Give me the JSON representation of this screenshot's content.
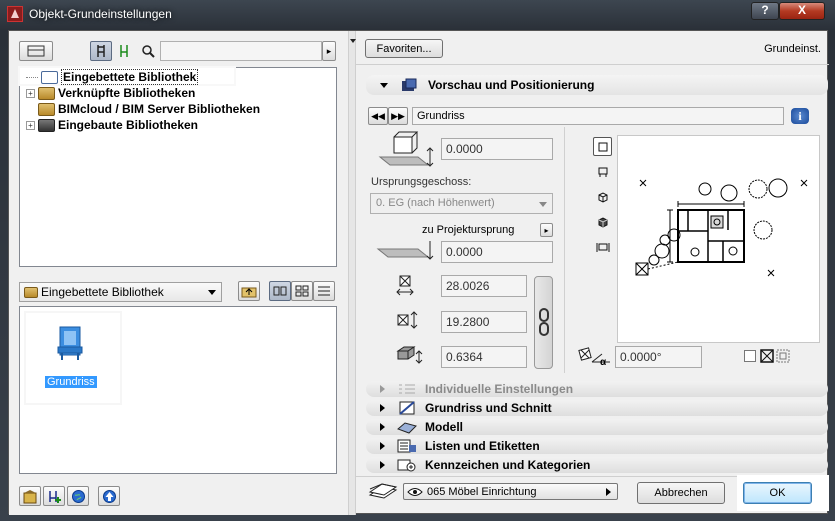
{
  "window": {
    "title": "Objekt-Grundeinstellungen",
    "help_label": "?",
    "close_label": "X"
  },
  "left": {
    "search": {
      "value": "",
      "placeholder": ""
    },
    "tree": [
      {
        "label": "Eingebettete Bibliothek",
        "expander": "",
        "selected": true
      },
      {
        "label": "Verknüpfte Bibliotheken",
        "expander": "+"
      },
      {
        "label": "BIMcloud / BIM Server Bibliotheken",
        "expander": ""
      },
      {
        "label": "Eingebaute Bibliotheken",
        "expander": "+"
      }
    ],
    "folder_select": {
      "value": "Eingebettete Bibliothek"
    },
    "items": [
      {
        "label": "Grundriss",
        "icon": "chair-icon"
      }
    ]
  },
  "right": {
    "favorites_label": "Favoriten...",
    "header_label": "Grundeinst.",
    "preview_section": {
      "label": "Vorschau und Positionierung"
    },
    "view_name": "Grundriss",
    "info_label": "i",
    "elevation_value": "0.0000",
    "home_story_label": "Ursprungsgeschoss:",
    "home_story_value": "0. EG (nach Höhenwert)",
    "to_project_zero_label": "zu Projektursprung",
    "project_zero_value": "0.0000",
    "width_value": "28.0026",
    "depth_value": "19.2800",
    "height_value": "0.6364",
    "angle_value": "0.0000°",
    "sections": [
      {
        "label": "Individuelle Einstellungen",
        "disabled": true
      },
      {
        "label": "Grundriss und Schnitt"
      },
      {
        "label": "Modell"
      },
      {
        "label": "Listen und Etiketten"
      },
      {
        "label": "Kennzeichen und Kategorien"
      }
    ],
    "layer_value": "065 Möbel Einrichtung",
    "cancel_label": "Abbrechen",
    "ok_label": "OK"
  },
  "colors": {
    "accent": "#3399ff",
    "title_bar": "#39414b",
    "close": "#b43a22"
  }
}
